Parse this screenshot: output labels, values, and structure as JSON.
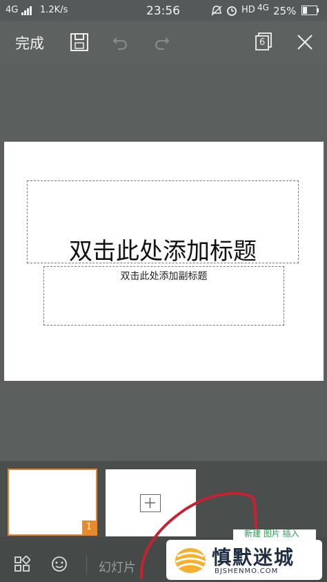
{
  "status": {
    "network": "4G",
    "speed": "1.2K/s",
    "time": "23:56",
    "hd": "HD",
    "net2": "4G",
    "battery": "25%"
  },
  "toolbar": {
    "done_label": "完成",
    "page_count": "6"
  },
  "slide": {
    "title_placeholder": "双击此处添加标题",
    "subtitle_placeholder": "双击此处添加副标题"
  },
  "thumbnails": {
    "slide_number": "1"
  },
  "bottom": {
    "slides_label": "幻灯片",
    "partial_label": "新建 图片 插入"
  },
  "watermark": {
    "brand": "慎默迷城",
    "domain": "BJSHENMO.COM"
  }
}
